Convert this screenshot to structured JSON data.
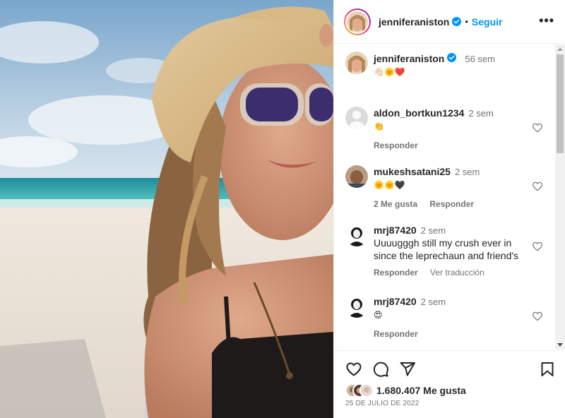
{
  "post": {
    "image_alt": "Selfie at the beach wearing a straw hat and sunglasses",
    "author": "jenniferaniston",
    "follow_label": "Seguir",
    "more_label": "•••",
    "dot": "•"
  },
  "caption": {
    "username": "jenniferaniston",
    "age": "56 sem",
    "text": "👋🏻🌞❤️"
  },
  "comments": [
    {
      "username": "aldon_bortkun1234",
      "age": "2 sem",
      "text": "👏",
      "actions": [
        "Responder"
      ]
    },
    {
      "username": "mukeshsatani25",
      "age": "2 sem",
      "text": "🌞🌞🖤",
      "actions": [
        "2 Me gusta",
        "Responder"
      ]
    },
    {
      "username": "mrj87420",
      "age": "2 sem",
      "text": "Uuuugggh still my crush ever in since the leprechaun and friend's",
      "actions": [
        "Responder",
        "Ver traducción"
      ]
    },
    {
      "username": "mrj87420",
      "age": "2 sem",
      "text": "😍",
      "actions": [
        "Responder"
      ]
    }
  ],
  "footer": {
    "likes": "1.680.407 Me gusta",
    "date": "25 DE JULIO DE 2022"
  },
  "colors": {
    "accent": "#0095f6",
    "verified": "#0095f6",
    "muted": "#737373"
  },
  "icons": [
    "verified-icon",
    "more-icon",
    "heart-icon",
    "comment-icon",
    "share-icon",
    "save-icon"
  ]
}
